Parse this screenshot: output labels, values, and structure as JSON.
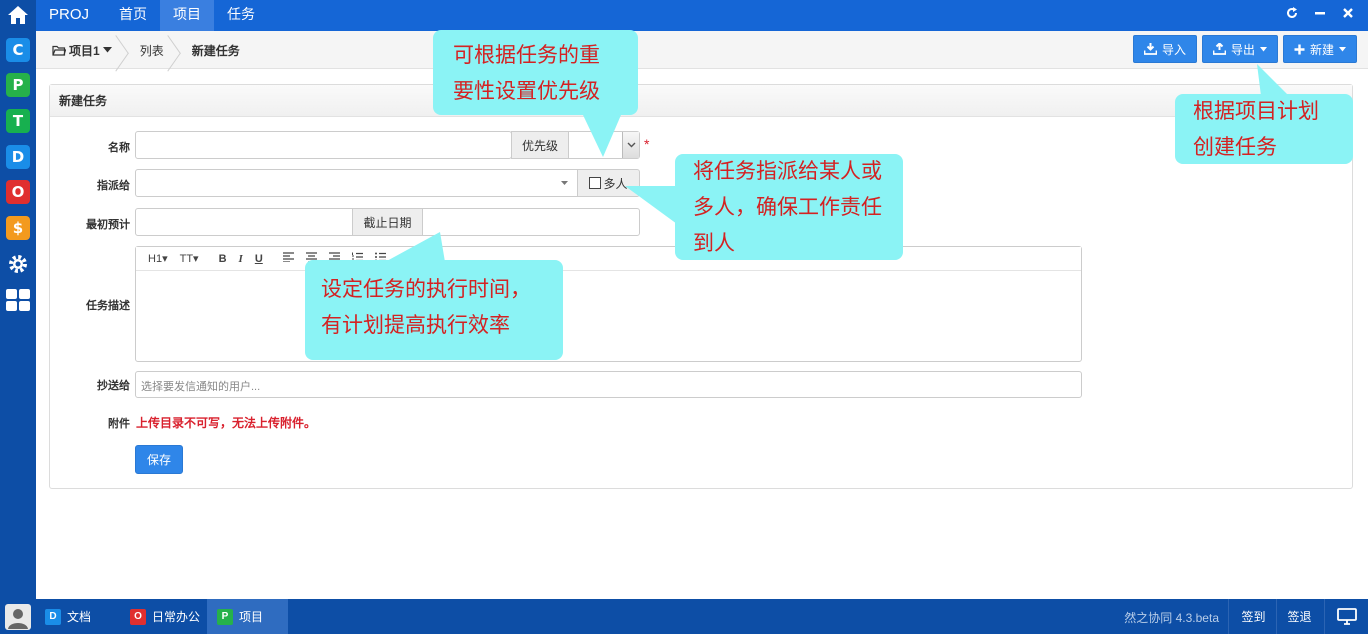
{
  "top": {
    "brand": "PROJ",
    "nav": [
      "首页",
      "项目",
      "任务"
    ],
    "active_nav": 1
  },
  "breadcrumb": {
    "project": "项目1",
    "list": "列表",
    "current": "新建任务"
  },
  "actions": {
    "import": "导入",
    "export": "导出",
    "new": "新建"
  },
  "panel": {
    "title": "新建任务"
  },
  "form": {
    "name_label": "名称",
    "priority_label": "优先级",
    "assign_label": "指派给",
    "multi_label": "多人",
    "estimate_label": "最初预计",
    "deadline_label": "截止日期",
    "desc_label": "任务描述",
    "cc_label": "抄送给",
    "cc_placeholder": "选择要发信通知的用户...",
    "attach_label": "附件",
    "attach_warning": "上传目录不可写，无法上传附件。",
    "save_label": "保存",
    "required_mark": "*"
  },
  "editor_toolbar": [
    "H1",
    "TT",
    "B",
    "I",
    "U"
  ],
  "callouts": {
    "priority": "可根据任务的重要性设置优先级",
    "plan": "根据项目计划创建任务",
    "assign": "将任务指派给某人或多人，确保工作责任到人",
    "time": "设定任务的执行时间，有计划提高执行效率"
  },
  "taskbar": {
    "items": [
      "文档",
      "日常办公",
      "项目"
    ],
    "active": 2,
    "version": "然之协同 4.3.beta",
    "signin": "签到",
    "signout": "签退"
  },
  "colors": {
    "rail": "#0d4ea6",
    "topbar": "#1566d6",
    "accent": "#2f86e9",
    "callout_bg": "#8bf3f5",
    "callout_text": "#d42222"
  }
}
